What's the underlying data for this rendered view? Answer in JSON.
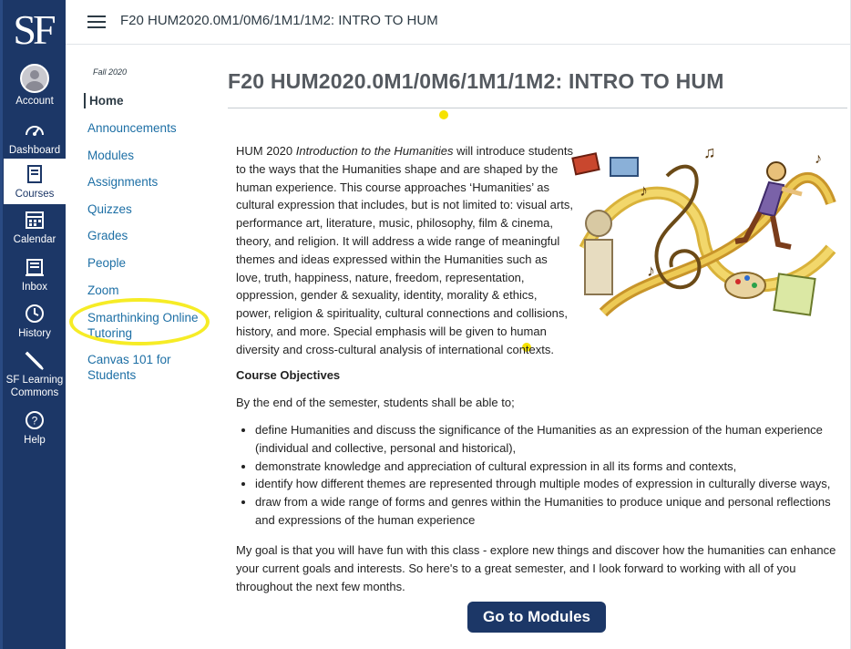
{
  "global_nav": {
    "logo": "SF",
    "items": [
      {
        "label": "Account",
        "icon": "account-avatar-icon"
      },
      {
        "label": "Dashboard",
        "icon": "speedometer-icon"
      },
      {
        "label": "Courses",
        "icon": "book-icon"
      },
      {
        "label": "Calendar",
        "icon": "calendar-icon"
      },
      {
        "label": "Inbox",
        "icon": "inbox-icon"
      },
      {
        "label": "History",
        "icon": "clock-icon"
      },
      {
        "label": "SF Learning Commons",
        "icon": "pencil-icon"
      },
      {
        "label": "Help",
        "icon": "help-icon"
      }
    ],
    "active": "Courses",
    "colors": {
      "background": "#1c3767",
      "active_bg": "#ffffff"
    }
  },
  "header": {
    "breadcrumb": "F20 HUM2020.0M1/0M6/1M1/1M2: INTRO TO HUM"
  },
  "course_nav": {
    "term": "Fall 2020",
    "items": [
      {
        "label": "Home",
        "active": true
      },
      {
        "label": "Announcements"
      },
      {
        "label": "Modules"
      },
      {
        "label": "Assignments"
      },
      {
        "label": "Quizzes"
      },
      {
        "label": "Grades"
      },
      {
        "label": "People"
      },
      {
        "label": "Zoom"
      },
      {
        "label": "Smarthinking Online Tutoring"
      },
      {
        "label": "Canvas 101 for Students"
      }
    ],
    "highlight_color": "#f6ec26"
  },
  "main": {
    "title": "F20 HUM2020.0M1/0M6/1M1/1M2: INTRO TO HUM",
    "intro_prefix": "HUM 2020 ",
    "intro_course": "Introduction to the Humanities",
    "intro_rest": " will introduce students to the ways that the Humanities shape and are shaped by the human experience. This course approaches ‘Humanities’ as cultural expression that includes, but is not limited to: visual arts, performance art, literature, music, philosophy, film & cinema, theory, and religion. It will address a wide range of meaningful themes and ideas expressed within the Humanities such as love, truth, happiness, nature, freedom, representation, oppression, gender & sexuality, identity, morality & ethics, power, religion & spirituality, cultural connections and collisions, history, and more.  Special emphasis will be given to human diversity and cross-cultural analysis of international contexts.",
    "objectives_title": "Course Objectives",
    "objectives_lead": "By the end of the semester, students shall be able to;",
    "objectives": [
      "define Humanities and discuss the significance of the Humanities as an expression of the human experience (individual and collective, personal and historical),",
      "demonstrate knowledge and appreciation of cultural expression in all its forms and contexts,",
      "identify how different themes are represented through multiple modes of expression in culturally diverse ways,",
      "draw from a wide range of forms and genres within the Humanities to produce unique and personal reflections and expressions of the human experience"
    ],
    "closing": "My goal is that you will have fun with this class - explore new things and discover how the humanities can enhance your current goals and interests. So here's to a great semester, and I look forward to working with all of you throughout the next few months.",
    "button_label": "Go to Modules",
    "hero_image": "humanities-illustration-treble-clef-runner"
  }
}
